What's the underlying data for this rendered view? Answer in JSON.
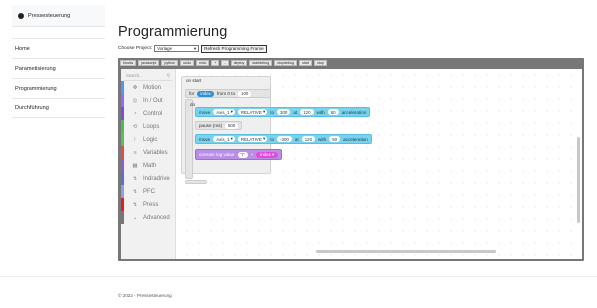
{
  "sidebar": {
    "brand": "Pressesteuerung",
    "items": [
      {
        "label": "Home"
      },
      {
        "label": "Parametisierung"
      },
      {
        "label": "Programmierung"
      },
      {
        "label": "Durchführung"
      }
    ]
  },
  "page": {
    "title": "Programmierung",
    "choose_label": "Choose Project:",
    "project_selected": "Vorlage",
    "refresh_label": "Refresh Programming Frame"
  },
  "toolbar": {
    "buttons": [
      "blocks",
      "javascript",
      "python",
      "undo",
      "redo",
      "+",
      "-",
      "deploy",
      "startdebug",
      "stopdebug",
      "start",
      "stop"
    ]
  },
  "toolbox": {
    "search_placeholder": "Search...",
    "categories": [
      {
        "label": "Motion",
        "icon": "move-icon",
        "glyph": "✥",
        "color": "#4c97ff"
      },
      {
        "label": "In / Out",
        "icon": "io-icon",
        "glyph": "◎",
        "color": "#9966ff"
      },
      {
        "label": "Control",
        "icon": "control-icon",
        "glyph": "◔",
        "color": "#7a4de0"
      },
      {
        "label": "Loops",
        "icon": "loop-icon",
        "glyph": "⟲",
        "color": "#4fbd49"
      },
      {
        "label": "Logic",
        "icon": "logic-icon",
        "glyph": "ᚭ",
        "color": "#59c059"
      },
      {
        "label": "Variables",
        "icon": "variables-icon",
        "glyph": "≡",
        "color": "#e64a4a"
      },
      {
        "label": "Math",
        "icon": "math-icon",
        "glyph": "▦",
        "color": "#8b5cd6"
      },
      {
        "label": "Indradrive",
        "icon": "drive-icon",
        "glyph": "↯",
        "color": "#5b6fd8"
      },
      {
        "label": "PFC",
        "icon": "pfc-icon",
        "glyph": "↯",
        "color": "#8e9ee0"
      },
      {
        "label": "Press",
        "icon": "press-icon",
        "glyph": "↯",
        "color": "#e81b23"
      },
      {
        "label": "Advanced",
        "icon": "chevron-down-icon",
        "glyph": "⌄",
        "color": "#777777"
      }
    ]
  },
  "blocks": {
    "on_start": "on start",
    "for_kw": "for",
    "for_var": "index",
    "for_from": "from 0 to",
    "for_to": "100",
    "do_kw": "do",
    "move1": {
      "kw": "move",
      "axis": "Axis_1",
      "mode": "RELATIVE",
      "to": "to",
      "pos": "300",
      "at": "at",
      "speed": "120",
      "with": "with",
      "acc": "50",
      "acc_label": "acceleration"
    },
    "pause": {
      "kw": "pause (ms)",
      "ms": "500"
    },
    "move2": {
      "kw": "move",
      "axis": "Axis_1",
      "mode": "RELATIVE",
      "to": "to",
      "pos": "-300",
      "at": "at",
      "speed": "120",
      "with": "with",
      "acc": "50",
      "acc_label": "acceleration"
    },
    "log": {
      "kw": "console log value",
      "str": "\"i\"",
      "plus": "+",
      "var": "index"
    }
  },
  "footer": "© 2022 - Pressesteuerung"
}
